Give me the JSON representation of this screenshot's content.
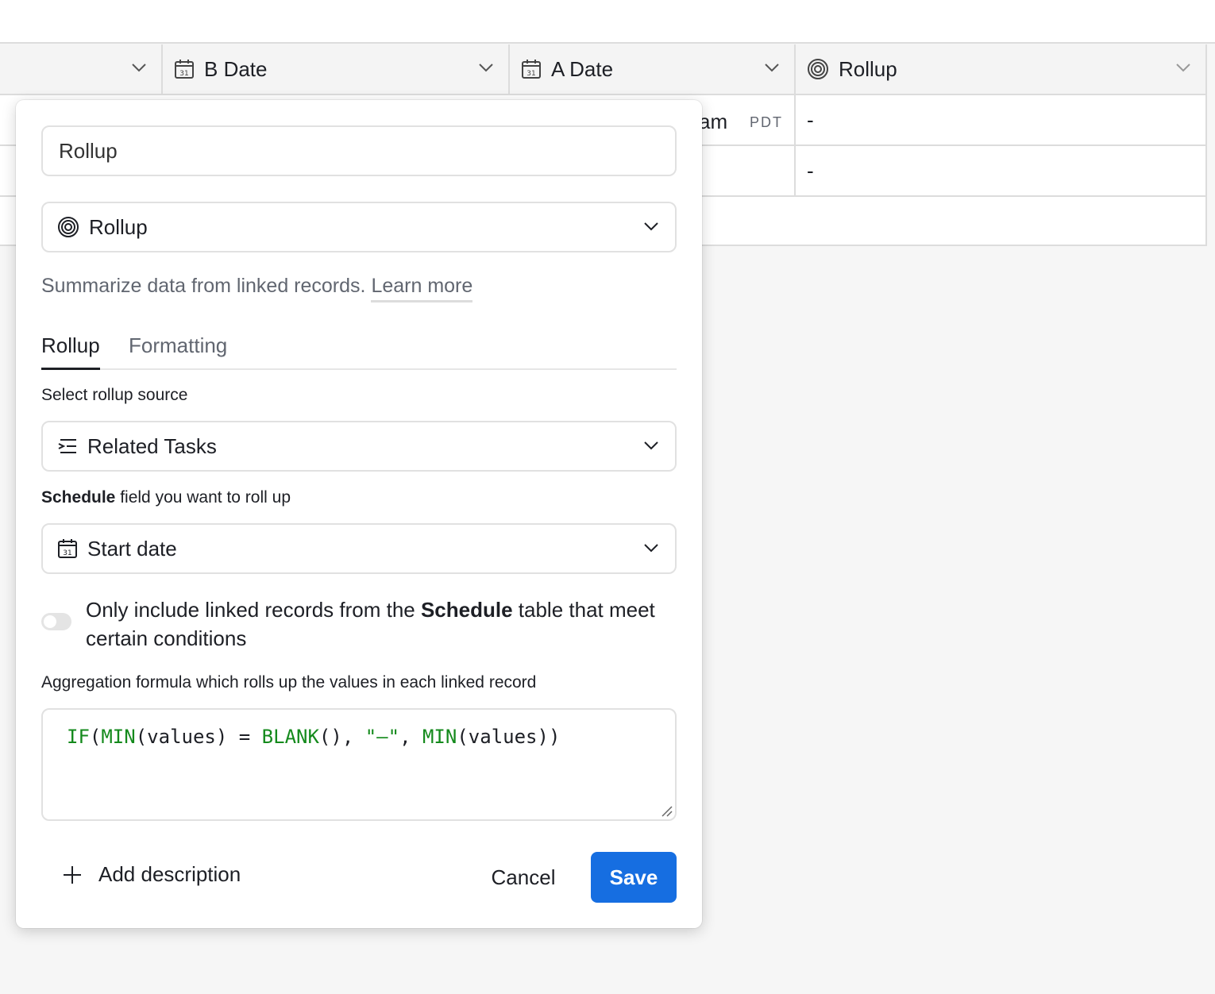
{
  "grid": {
    "columns": [
      {
        "label": ""
      },
      {
        "label": "B Date"
      },
      {
        "label": "A Date"
      },
      {
        "label": "Rollup"
      }
    ],
    "rows": [
      {
        "partial_value": "am",
        "timezone": "PDT",
        "rollup": "-"
      },
      {
        "partial_value": "",
        "timezone": "",
        "rollup": "-"
      }
    ]
  },
  "panel": {
    "field_name": "Rollup",
    "field_type": "Rollup",
    "description": "Summarize data from linked records.",
    "learn_more": "Learn more",
    "tabs": [
      {
        "label": "Rollup",
        "active": true
      },
      {
        "label": "Formatting",
        "active": false
      }
    ],
    "source_label": "Select rollup source",
    "source_value": "Related Tasks",
    "field_label_bold": "Schedule",
    "field_label_rest": " field you want to roll up",
    "field_value": "Start date",
    "toggle": {
      "on": false,
      "text_pre": "Only include linked records from the ",
      "text_bold": "Schedule",
      "text_post": " table that meet certain conditions"
    },
    "formula_label": "Aggregation formula which rolls up the values in each linked record",
    "formula": {
      "p1": "IF",
      "p2": "(",
      "p3": "MIN",
      "p4": "(values) = ",
      "p5": "BLANK",
      "p6": "(), ",
      "p7": "\"–\"",
      "p8": ", ",
      "p9": "MIN",
      "p10": "(values))"
    },
    "add_description": "Add description",
    "cancel": "Cancel",
    "save": "Save"
  },
  "colors": {
    "accent": "#166ee1",
    "formula_function": "#148a1c"
  }
}
